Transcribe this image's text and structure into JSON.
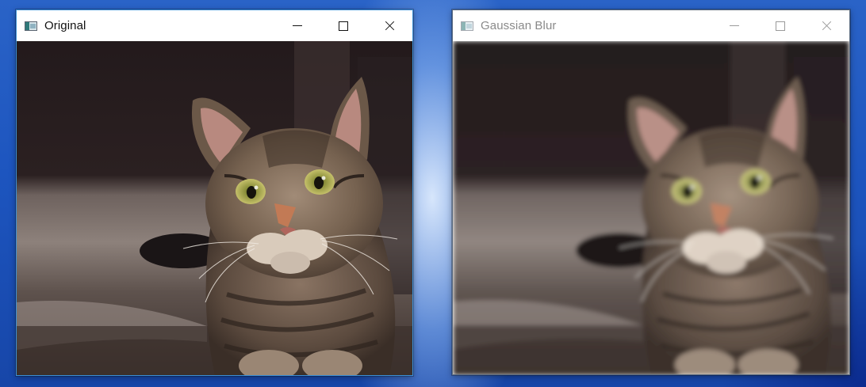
{
  "windows": [
    {
      "title": "Original",
      "state": "active",
      "image": "tabby-cat-photo",
      "blur": 0
    },
    {
      "title": "Gaussian Blur",
      "state": "inactive",
      "image": "tabby-cat-photo-blurred",
      "blur": 3
    }
  ],
  "icons": {
    "app": "opencv-window-icon",
    "minimize": "minimize-icon",
    "maximize": "maximize-icon",
    "close": "close-icon"
  },
  "colors": {
    "desktop": "#1d55bf",
    "active_border": "#3c8fd6",
    "inactive_title": "#8a8a8a"
  }
}
